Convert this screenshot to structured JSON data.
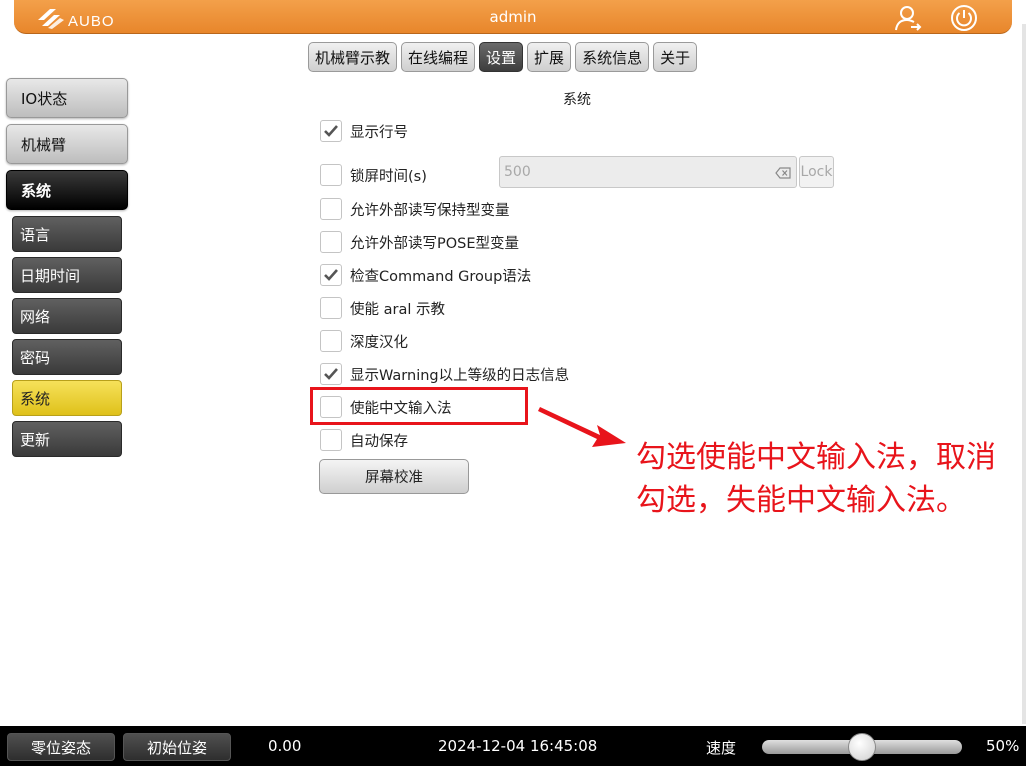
{
  "header": {
    "logo_text": "AUBO",
    "title": "admin",
    "icons": [
      "user-switch-icon",
      "power-icon"
    ]
  },
  "top_tabs": [
    {
      "label": "机械臂示教",
      "active": false
    },
    {
      "label": "在线编程",
      "active": false
    },
    {
      "label": "设置",
      "active": true
    },
    {
      "label": "扩展",
      "active": false
    },
    {
      "label": "系统信息",
      "active": false
    },
    {
      "label": "关于",
      "active": false
    }
  ],
  "sidebar": {
    "main_items": [
      {
        "label": "IO状态",
        "active": false
      },
      {
        "label": "机械臂",
        "active": false
      },
      {
        "label": "系统",
        "active": true
      }
    ],
    "sub_items": [
      {
        "label": "语言",
        "active": false
      },
      {
        "label": "日期时间",
        "active": false
      },
      {
        "label": "网络",
        "active": false
      },
      {
        "label": "密码",
        "active": false
      },
      {
        "label": "系统",
        "active": true
      },
      {
        "label": "更新",
        "active": false
      }
    ]
  },
  "main": {
    "section_title": "系统",
    "options": [
      {
        "label": "显示行号",
        "checked": true
      },
      {
        "label": "锁屏时间(s)",
        "checked": false
      },
      {
        "label": "允许外部读写保持型变量",
        "checked": false
      },
      {
        "label": "允许外部读写POSE型变量",
        "checked": false
      },
      {
        "label": "检查Command Group语法",
        "checked": true
      },
      {
        "label": "使能 aral 示教",
        "checked": false
      },
      {
        "label": "深度汉化",
        "checked": false
      },
      {
        "label": "显示Warning以上等级的日志信息",
        "checked": true
      },
      {
        "label": "使能中文输入法",
        "checked": false
      },
      {
        "label": "自动保存",
        "checked": false
      }
    ],
    "lock_time_value": "500",
    "lock_button_label": "Lock",
    "calibrate_button_label": "屏幕校准"
  },
  "annotation": {
    "text": "勾选使能中文输入法，取消勾选，失能中文输入法。",
    "color": "#e8141b"
  },
  "footer": {
    "zero_pose_label": "零位姿态",
    "init_pose_label": "初始位姿",
    "value_readout": "0.00",
    "datetime": "2024-12-04 16:45:08",
    "speed_label": "速度",
    "speed_percent": 50,
    "speed_text": "50%"
  },
  "colors": {
    "header_orange": "#e8862b",
    "active_sub_yellow": "#dfc11a",
    "annotation_red": "#e8141b"
  }
}
